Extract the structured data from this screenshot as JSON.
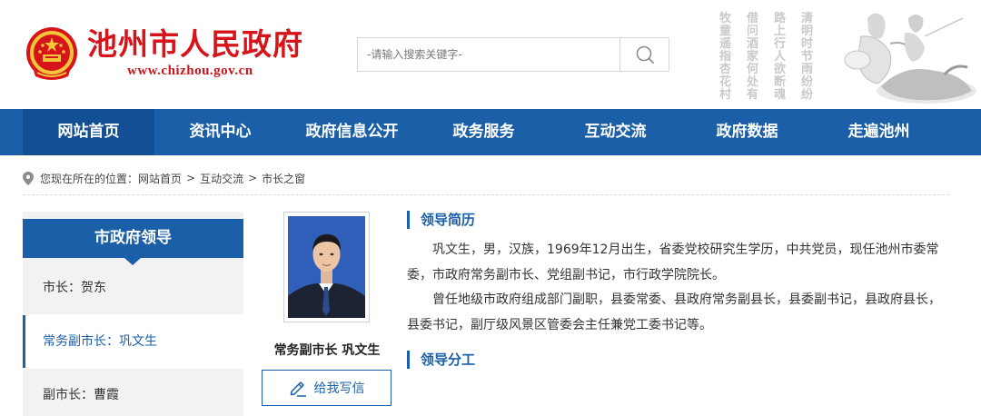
{
  "header": {
    "site_title": "池州市人民政府",
    "site_url": "www.chizhou.gov.cn",
    "search_placeholder": "-请输入搜索关键字-",
    "poem_columns": [
      "清明时节雨纷纷",
      "路上行人欲断魂",
      "借问酒家何处有",
      "牧童遥指杏花村"
    ],
    "search_icon": "search-icon",
    "emblem_icon": "national-emblem-icon"
  },
  "nav": {
    "items": [
      "网站首页",
      "资讯中心",
      "政府信息公开",
      "政务服务",
      "互动交流",
      "政府数据",
      "走遍池州"
    ],
    "active_index": 0
  },
  "breadcrumb": {
    "prefix": "您现在所在的位置：",
    "items": [
      "网站首页",
      "互动交流",
      "市长之窗"
    ],
    "separator": ">",
    "icon": "location-pin-icon"
  },
  "sidebar": {
    "title": "市政府领导",
    "items": [
      {
        "label": "市长：贺东",
        "active": false
      },
      {
        "label": "常务副市长：巩文生",
        "active": true
      },
      {
        "label": "副市长：曹霞",
        "active": false
      }
    ]
  },
  "profile": {
    "caption": "常务副市长 巩文生",
    "write_button": "给我写信",
    "write_icon": "pencil-icon",
    "photo": "portrait-photo"
  },
  "bio": {
    "resume_title": "领导简历",
    "paragraphs": [
      "巩文生，男，汉族，1969年12月出生，省委党校研究生学历，中共党员，现任池州市委常委，市政府常务副市长、党组副书记，市行政学院院长。",
      "曾任地级市政府组成部门副职，县委常委、县政府常务副县长，县委副书记，县政府县长，县委书记，副厅级风景区管委会主任兼党工委书记等。"
    ],
    "duty_title": "领导分工"
  },
  "colors": {
    "brand_blue": "#1a5fa8",
    "title_red": "#d6141a",
    "sidebar_bg": "#f2f2f2"
  }
}
